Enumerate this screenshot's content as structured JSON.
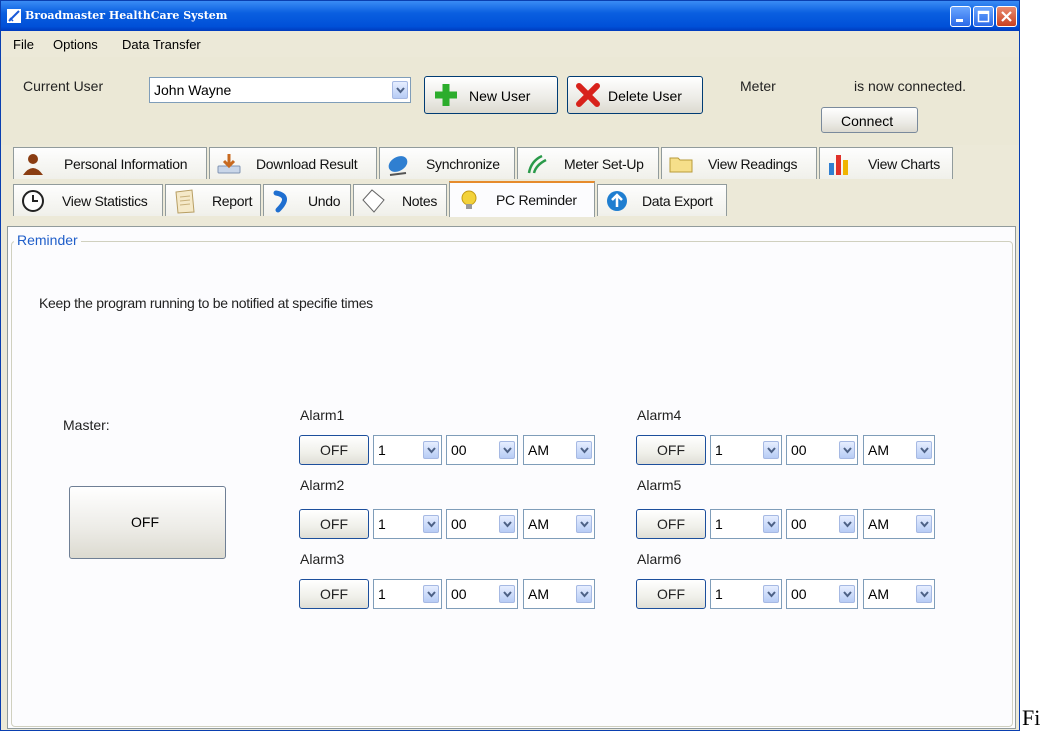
{
  "window": {
    "title": "Broadmaster HealthCare System"
  },
  "menu": [
    "File",
    "Options",
    "Data Transfer"
  ],
  "user": {
    "label": "Current User",
    "selected": "John Wayne",
    "new_user": "New User",
    "delete_user": "Delete User",
    "meter_label": "Meter",
    "status": "is now connected.",
    "connect": "Connect"
  },
  "tabs_row1": [
    {
      "label": "Personal Information",
      "icon": "person-icon"
    },
    {
      "label": "Download Result",
      "icon": "download-icon"
    },
    {
      "label": "Synchronize",
      "icon": "satellite-icon"
    },
    {
      "label": "Meter Set-Up",
      "icon": "signal-icon"
    },
    {
      "label": "View Readings",
      "icon": "folder-icon"
    },
    {
      "label": "View Charts",
      "icon": "bar-chart-icon"
    }
  ],
  "tabs_row2": [
    {
      "label": "View Statistics",
      "icon": "clock-icon"
    },
    {
      "label": "Report",
      "icon": "notepad-icon"
    },
    {
      "label": "Undo",
      "icon": "undo-arrow-icon"
    },
    {
      "label": "Notes",
      "icon": "note-page-icon"
    },
    {
      "label": "PC Reminder",
      "icon": "bulb-icon",
      "active": true
    },
    {
      "label": "Data Export",
      "icon": "upload-icon"
    }
  ],
  "reminder": {
    "group_title": "Reminder",
    "instruction": "Keep the program running to be notified at specifie times",
    "master_label": "Master:",
    "master_button": "OFF",
    "alarms": [
      {
        "label": "Alarm1",
        "button": "OFF",
        "hour": "1",
        "minute": "00",
        "ampm": "AM"
      },
      {
        "label": "Alarm2",
        "button": "OFF",
        "hour": "1",
        "minute": "00",
        "ampm": "AM"
      },
      {
        "label": "Alarm3",
        "button": "OFF",
        "hour": "1",
        "minute": "00",
        "ampm": "AM"
      },
      {
        "label": "Alarm4",
        "button": "OFF",
        "hour": "1",
        "minute": "00",
        "ampm": "AM"
      },
      {
        "label": "Alarm5",
        "button": "OFF",
        "hour": "1",
        "minute": "00",
        "ampm": "AM"
      },
      {
        "label": "Alarm6",
        "button": "OFF",
        "hour": "1",
        "minute": "00",
        "ampm": "AM"
      }
    ]
  },
  "page_caption_fragment": "Fi",
  "colors": {
    "titlebar": "#0054e3",
    "accent_tab": "#e68b2c",
    "group_title": "#1f5ec9"
  }
}
